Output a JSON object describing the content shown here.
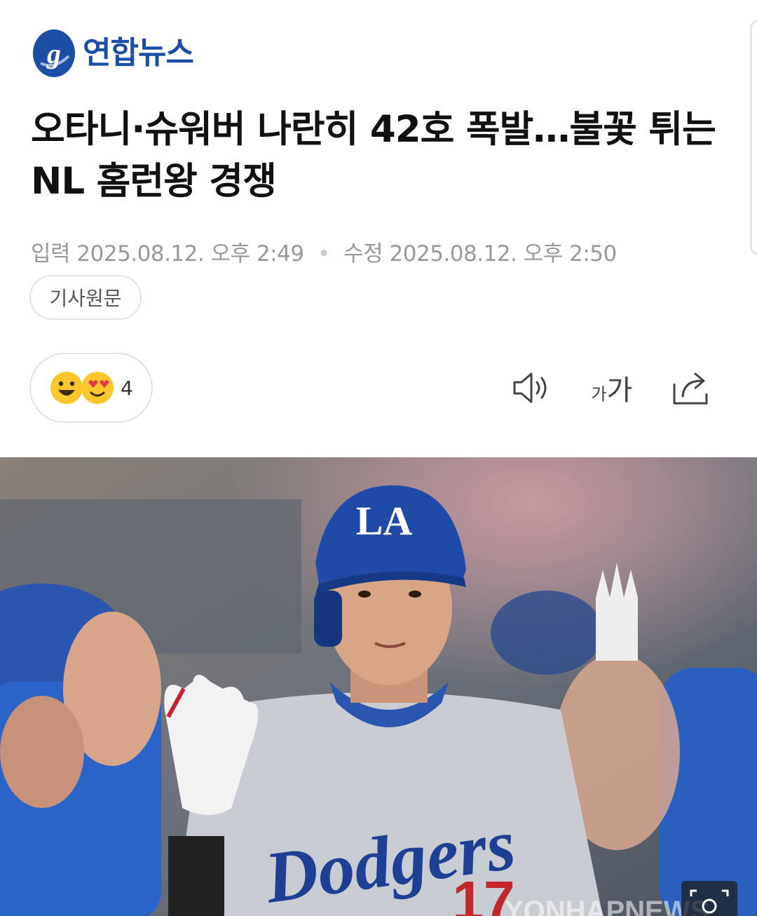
{
  "header": {
    "brand_name": "연합뉴스",
    "brand_color": "#1d4ea6",
    "logo_icon": "yonhap-logo-icon"
  },
  "article": {
    "headline": "오타니·슈워버 나란히 42호 폭발…불꽃 튀는 NL 홈런왕 경쟁",
    "published_label": "입력",
    "published_time": "2025.08.12. 오후 2:49",
    "modified_label": "수정",
    "modified_time": "2025.08.12. 오후 2:50",
    "separator": "•",
    "source_button": "기사원문"
  },
  "toolbar": {
    "reaction_icons": [
      "smile-emoji-icon",
      "heart-eyes-emoji-icon"
    ],
    "reaction_count": "4",
    "speaker_icon": "speaker-icon",
    "font_small": "가",
    "font_large": "가",
    "share_icon": "share-icon"
  },
  "photo": {
    "watermark": "YONHAPNEWS",
    "jersey_text": "Dodgers",
    "helmet_text": "LA",
    "zoom_icon": "zoom-icon"
  }
}
